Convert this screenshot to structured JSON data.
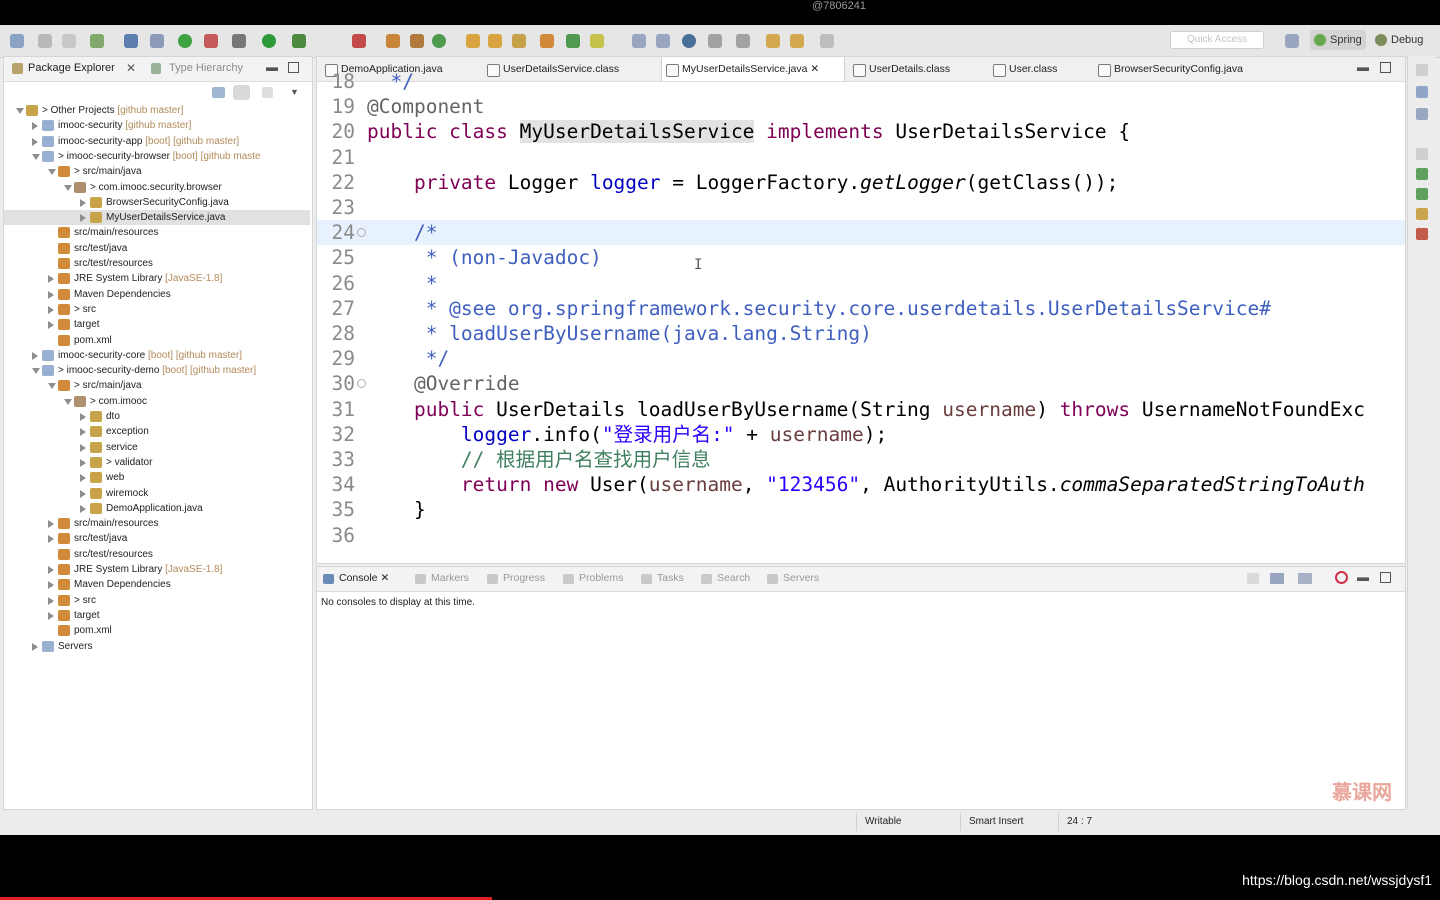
{
  "watermark_top": "@7806241",
  "toolbar": {
    "quick_access_placeholder": "Quick Access",
    "perspectives": [
      "Spring",
      "Debug"
    ]
  },
  "package_explorer": {
    "tabs": [
      "Package Explorer",
      "Type Hierarchy"
    ],
    "tree": [
      {
        "label": "> Other Projects",
        "suffix": "[github master]",
        "depth": 0,
        "open": true
      },
      {
        "label": "imooc-security",
        "suffix": "[github master]",
        "depth": 1,
        "open": false
      },
      {
        "label": "imooc-security-app",
        "suffix": "[boot] [github master]",
        "depth": 1,
        "open": false
      },
      {
        "label": "> imooc-security-browser",
        "suffix": "[boot] [github maste",
        "depth": 1,
        "open": true
      },
      {
        "label": "> src/main/java",
        "suffix": "",
        "depth": 2,
        "open": true
      },
      {
        "label": "> com.imooc.security.browser",
        "suffix": "",
        "depth": 3,
        "open": true
      },
      {
        "label": "BrowserSecurityConfig.java",
        "suffix": "",
        "depth": 4,
        "open": false
      },
      {
        "label": "MyUserDetailsService.java",
        "suffix": "",
        "depth": 4,
        "open": false,
        "selected": true
      },
      {
        "label": "src/main/resources",
        "suffix": "",
        "depth": 2,
        "open": null
      },
      {
        "label": "src/test/java",
        "suffix": "",
        "depth": 2,
        "open": null
      },
      {
        "label": "src/test/resources",
        "suffix": "",
        "depth": 2,
        "open": null
      },
      {
        "label": "JRE System Library",
        "suffix": "[JavaSE-1.8]",
        "depth": 2,
        "open": false
      },
      {
        "label": "Maven Dependencies",
        "suffix": "",
        "depth": 2,
        "open": false
      },
      {
        "label": "> src",
        "suffix": "",
        "depth": 2,
        "open": false
      },
      {
        "label": "target",
        "suffix": "",
        "depth": 2,
        "open": false
      },
      {
        "label": "pom.xml",
        "suffix": "",
        "depth": 2,
        "open": null
      },
      {
        "label": "imooc-security-core",
        "suffix": "[boot] [github master]",
        "depth": 1,
        "open": false
      },
      {
        "label": "> imooc-security-demo",
        "suffix": "[boot] [github master]",
        "depth": 1,
        "open": true
      },
      {
        "label": "> src/main/java",
        "suffix": "",
        "depth": 2,
        "open": true
      },
      {
        "label": "> com.imooc",
        "suffix": "",
        "depth": 3,
        "open": true
      },
      {
        "label": "dto",
        "suffix": "",
        "depth": 4,
        "open": false
      },
      {
        "label": "exception",
        "suffix": "",
        "depth": 4,
        "open": false
      },
      {
        "label": "service",
        "suffix": "",
        "depth": 4,
        "open": false
      },
      {
        "label": "> validator",
        "suffix": "",
        "depth": 4,
        "open": false
      },
      {
        "label": "web",
        "suffix": "",
        "depth": 4,
        "open": false
      },
      {
        "label": "wiremock",
        "suffix": "",
        "depth": 4,
        "open": false
      },
      {
        "label": "DemoApplication.java",
        "suffix": "",
        "depth": 4,
        "open": false
      },
      {
        "label": "src/main/resources",
        "suffix": "",
        "depth": 2,
        "open": false
      },
      {
        "label": "src/test/java",
        "suffix": "",
        "depth": 2,
        "open": false
      },
      {
        "label": "src/test/resources",
        "suffix": "",
        "depth": 2,
        "open": null
      },
      {
        "label": "JRE System Library",
        "suffix": "[JavaSE-1.8]",
        "depth": 2,
        "open": false
      },
      {
        "label": "Maven Dependencies",
        "suffix": "",
        "depth": 2,
        "open": false
      },
      {
        "label": "> src",
        "suffix": "",
        "depth": 2,
        "open": false
      },
      {
        "label": "target",
        "suffix": "",
        "depth": 2,
        "open": false
      },
      {
        "label": "pom.xml",
        "suffix": "",
        "depth": 2,
        "open": null
      },
      {
        "label": "Servers",
        "suffix": "",
        "depth": 1,
        "open": false
      }
    ]
  },
  "editor": {
    "tabs": [
      "DemoApplication.java",
      "UserDetailsService.class",
      "MyUserDetailsService.java",
      "UserDetails.class",
      "User.class",
      "BrowserSecurityConfig.java"
    ],
    "active_tab": "MyUserDetailsService.java",
    "lines": [
      {
        "n": "18",
        "tokens": [
          [
            "jd",
            "  */"
          ]
        ]
      },
      {
        "n": "19",
        "tokens": [
          [
            "an",
            "@Component"
          ]
        ]
      },
      {
        "n": "20",
        "tokens": [
          [
            "kw",
            "public class "
          ],
          [
            "hl",
            "MyUserDetailsService"
          ],
          [
            "kw",
            " implements "
          ],
          [
            "",
            "UserDetailsService {"
          ]
        ]
      },
      {
        "n": "21",
        "tokens": []
      },
      {
        "n": "22",
        "tokens": [
          [
            "",
            "    "
          ],
          [
            "kw",
            "private "
          ],
          [
            "",
            "Logger "
          ],
          [
            "fd",
            "logger"
          ],
          [
            "",
            " = LoggerFactory."
          ],
          [
            "it",
            "getLogger"
          ],
          [
            "",
            "(getClass());"
          ]
        ]
      },
      {
        "n": "23",
        "tokens": []
      },
      {
        "n": "24",
        "tokens": [
          [
            "jd",
            "    /*"
          ]
        ],
        "current": true,
        "fold": true
      },
      {
        "n": "25",
        "tokens": [
          [
            "jd",
            "     * (non-Javadoc)"
          ]
        ]
      },
      {
        "n": "26",
        "tokens": [
          [
            "jd",
            "     *"
          ]
        ]
      },
      {
        "n": "27",
        "tokens": [
          [
            "jd",
            "     * @see org.springframework.security.core.userdetails.UserDetailsService#"
          ]
        ]
      },
      {
        "n": "28",
        "tokens": [
          [
            "jd",
            "     * loadUserByUsername(java.lang.String)"
          ]
        ]
      },
      {
        "n": "29",
        "tokens": [
          [
            "jd",
            "     */"
          ]
        ]
      },
      {
        "n": "30",
        "tokens": [
          [
            "an",
            "    @Override"
          ]
        ],
        "fold": true
      },
      {
        "n": "31",
        "tokens": [
          [
            "",
            "    "
          ],
          [
            "kw",
            "public "
          ],
          [
            "",
            "UserDetails loadUserByUsername(String "
          ],
          [
            "pa",
            "username"
          ],
          [
            "",
            ") "
          ],
          [
            "kw",
            "throws "
          ],
          [
            "",
            "UsernameNotFoundExc"
          ]
        ]
      },
      {
        "n": "32",
        "tokens": [
          [
            "",
            "        "
          ],
          [
            "fd",
            "logger"
          ],
          [
            "",
            ".info("
          ],
          [
            "st",
            "\"登录用户名:\""
          ],
          [
            "",
            " + "
          ],
          [
            "pa",
            "username"
          ],
          [
            "",
            ");"
          ]
        ]
      },
      {
        "n": "33",
        "tokens": [
          [
            "cm",
            "        // 根据用户名查找用户信息"
          ]
        ]
      },
      {
        "n": "34",
        "tokens": [
          [
            "",
            "        "
          ],
          [
            "kw",
            "return new "
          ],
          [
            "",
            "User("
          ],
          [
            "pa",
            "username"
          ],
          [
            "",
            ", "
          ],
          [
            "st",
            "\"123456\""
          ],
          [
            "",
            ", AuthorityUtils."
          ],
          [
            "it",
            "commaSeparatedStringToAuth"
          ]
        ]
      },
      {
        "n": "35",
        "tokens": [
          [
            "",
            "    }"
          ]
        ]
      },
      {
        "n": "36",
        "tokens": []
      }
    ]
  },
  "console": {
    "tabs": [
      "Console",
      "Markers",
      "Progress",
      "Problems",
      "Tasks",
      "Search",
      "Servers"
    ],
    "message": "No consoles to display at this time."
  },
  "status": {
    "mode": "Writable",
    "insert": "Smart Insert",
    "position": "24 : 7"
  },
  "watermark_right": "慕课网",
  "url": "https://blog.csdn.net/wssjdysf1"
}
